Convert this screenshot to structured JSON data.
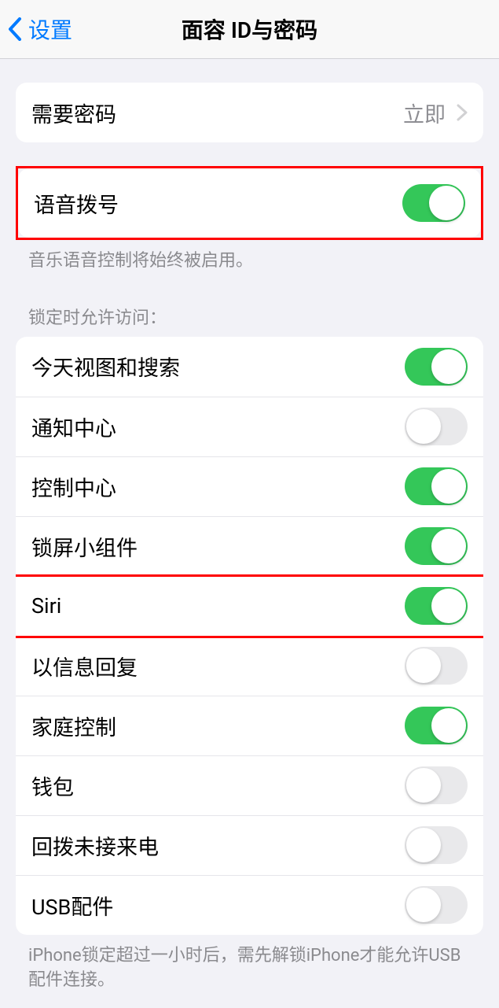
{
  "nav": {
    "back_label": "设置",
    "title": "面容 ID与密码"
  },
  "require_passcode": {
    "label": "需要密码",
    "value": "立即"
  },
  "voice_dial": {
    "label": "语音拨号",
    "on": true,
    "footer": "音乐语音控制将始终被启用。"
  },
  "access_header": "锁定时允许访问：",
  "access": [
    {
      "label": "今天视图和搜索",
      "on": true
    },
    {
      "label": "通知中心",
      "on": false
    },
    {
      "label": "控制中心",
      "on": true
    },
    {
      "label": "锁屏小组件",
      "on": true
    },
    {
      "label": "Siri",
      "on": true
    },
    {
      "label": "以信息回复",
      "on": false
    },
    {
      "label": "家庭控制",
      "on": true
    },
    {
      "label": "钱包",
      "on": false
    },
    {
      "label": "回拨未接来电",
      "on": false
    },
    {
      "label": "USB配件",
      "on": false
    }
  ],
  "usb_footer": "iPhone锁定超过一小时后，需先解锁iPhone才能允许USB配件连接。"
}
